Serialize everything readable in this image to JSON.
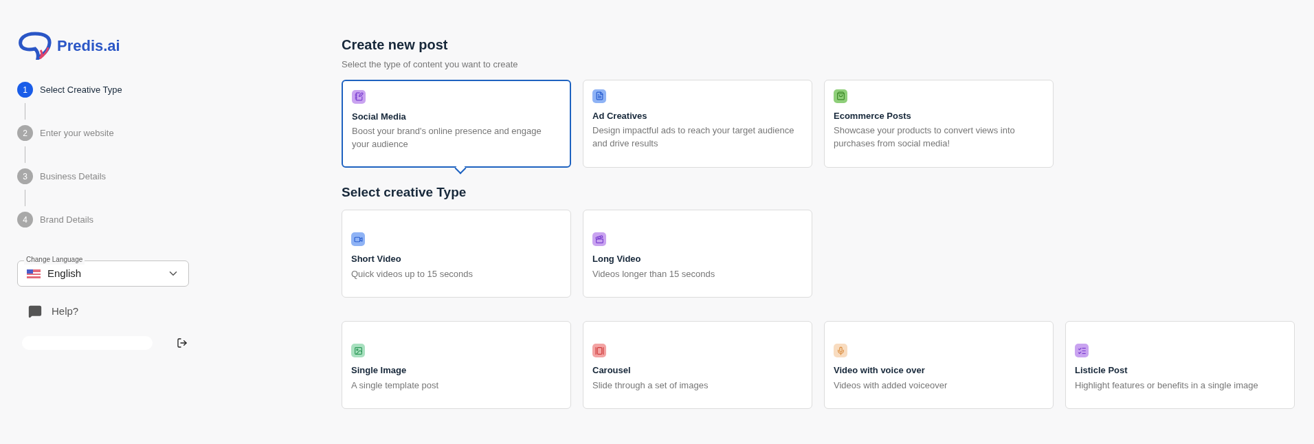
{
  "brand": {
    "name": "Predis.ai"
  },
  "steps": [
    {
      "number": "1",
      "label": "Select Creative Type",
      "selected": true
    },
    {
      "number": "2",
      "label": "Enter your website",
      "selected": false
    },
    {
      "number": "3",
      "label": "Business Details",
      "selected": false
    },
    {
      "number": "4",
      "label": "Brand Details",
      "selected": false
    }
  ],
  "language": {
    "label": "Change Language",
    "value": "English"
  },
  "help": {
    "label": "Help?"
  },
  "header": {
    "title": "Create new post",
    "subtitle": "Select the type of content you want to create"
  },
  "post_types": [
    {
      "kind": "social",
      "title": "Social Media",
      "description": "Boost your brand's online presence and engage your audience",
      "selected": true
    },
    {
      "kind": "ad",
      "title": "Ad Creatives",
      "description": "Design impactful ads to reach your target audience and drive results",
      "selected": false
    },
    {
      "kind": "ecommerce",
      "title": "Ecommerce Posts",
      "description": "Showcase your products to convert views into purchases from social media!",
      "selected": false
    }
  ],
  "creative_heading": "Select creative Type",
  "video_types": [
    {
      "kind": "short-video",
      "title": "Short Video",
      "description": "Quick videos up to 15 seconds"
    },
    {
      "kind": "long-video",
      "title": "Long Video",
      "description": "Videos longer than 15 seconds"
    }
  ],
  "format_types": [
    {
      "kind": "image",
      "title": "Single Image",
      "description": "A single template post"
    },
    {
      "kind": "carousel",
      "title": "Carousel",
      "description": "Slide through a set of images"
    },
    {
      "kind": "voice",
      "title": "Video with voice over",
      "description": "Videos with added voiceover"
    },
    {
      "kind": "listicle",
      "title": "Listicle Post",
      "description": "Highlight features or benefits in a single image"
    }
  ]
}
